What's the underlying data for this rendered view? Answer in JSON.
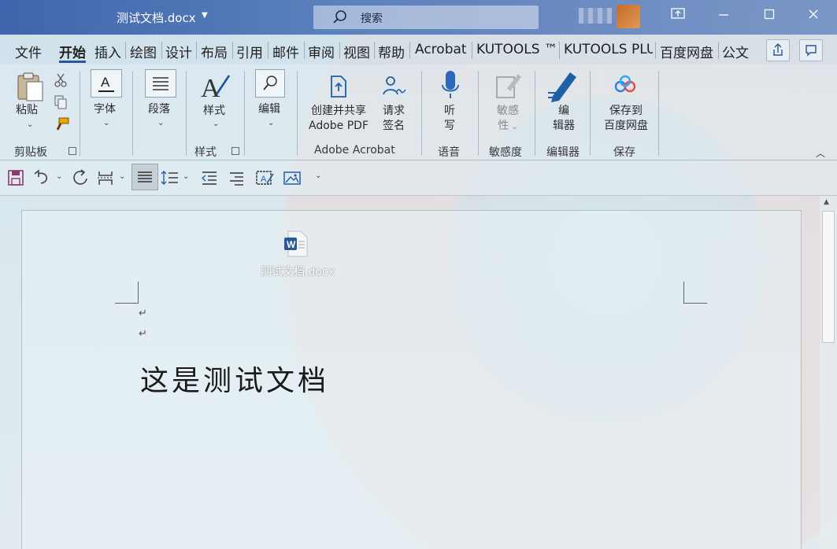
{
  "window": {
    "title": "测试文档.docx",
    "search_placeholder": "搜索"
  },
  "tabs": [
    {
      "label": "文件"
    },
    {
      "label": "开始"
    },
    {
      "label": "插入"
    },
    {
      "label": "绘图"
    },
    {
      "label": "设计"
    },
    {
      "label": "布局"
    },
    {
      "label": "引用"
    },
    {
      "label": "邮件"
    },
    {
      "label": "审阅"
    },
    {
      "label": "视图"
    },
    {
      "label": "帮助"
    },
    {
      "label": "Acrobat"
    },
    {
      "label": "KUTOOLS ™"
    },
    {
      "label": "KUTOOLS PLU"
    },
    {
      "label": "百度网盘"
    },
    {
      "label": "公文"
    }
  ],
  "active_tab": "开始",
  "ribbon": {
    "paste": "粘贴",
    "font": "字体",
    "paragraph": "段落",
    "styles": "样式",
    "editing": "编辑",
    "create_share_line1": "创建并共享",
    "create_share_line2": "Adobe PDF",
    "request_sign_line1": "请求",
    "request_sign_line2": "签名",
    "dictate_line1": "听",
    "dictate_line2": "写",
    "sensitivity_line1": "敏感",
    "sensitivity_line2": "性",
    "editor_line1": "编",
    "editor_line2": "辑器",
    "save_line1": "保存到",
    "save_line2": "百度网盘",
    "groups": {
      "clipboard": "剪贴板",
      "styles": "样式",
      "adobe": "Adobe Acrobat",
      "voice": "语音",
      "sensitivity": "敏感度",
      "editor": "编辑器",
      "save": "保存"
    }
  },
  "document": {
    "heading": "这是测试文档",
    "paragraph_mark": "↵"
  },
  "desktop_icon": {
    "label": "测试文档.docx"
  },
  "colors": {
    "titlebar": "#3a5ea8",
    "accent": "#2b5797"
  }
}
